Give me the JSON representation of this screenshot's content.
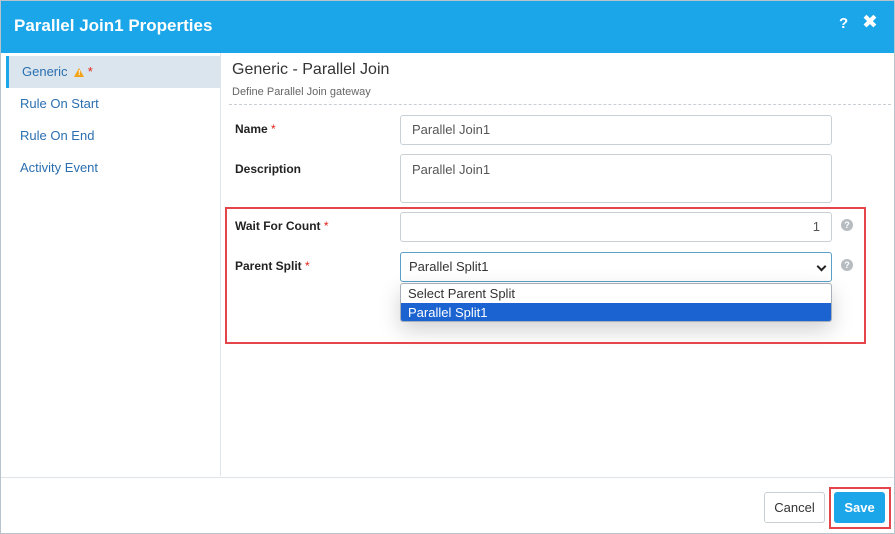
{
  "dialog": {
    "title": "Parallel Join1 Properties",
    "help_symbol": "?",
    "close_symbol": "✖"
  },
  "sidebar": {
    "items": [
      {
        "label": "Generic",
        "required_mark": "*",
        "active": true,
        "has_warning": true
      },
      {
        "label": "Rule On Start"
      },
      {
        "label": "Rule On End"
      },
      {
        "label": "Activity Event"
      }
    ]
  },
  "section": {
    "title": "Generic - Parallel Join",
    "subtitle": "Define Parallel Join gateway"
  },
  "form": {
    "name": {
      "label": "Name",
      "required_mark": "*",
      "value": "Parallel Join1"
    },
    "description": {
      "label": "Description",
      "value": "Parallel Join1"
    },
    "wait_for_count": {
      "label": "Wait For Count",
      "required_mark": "*",
      "value": "1"
    },
    "parent_split": {
      "label": "Parent Split",
      "required_mark": "*",
      "value": "Parallel Split1",
      "options": [
        "Select Parent Split",
        "Parallel Split1"
      ],
      "selected_index": 1
    }
  },
  "footer": {
    "cancel_label": "Cancel",
    "save_label": "Save"
  },
  "colors": {
    "accent": "#1ca6ea",
    "highlight": "#e4454b",
    "warning": "#f3a317",
    "option_selected": "#1a63d1"
  },
  "icons": {
    "warning": "warning-icon",
    "help": "help-icon",
    "close": "close-icon",
    "dropdown": "chevron-down-icon"
  }
}
